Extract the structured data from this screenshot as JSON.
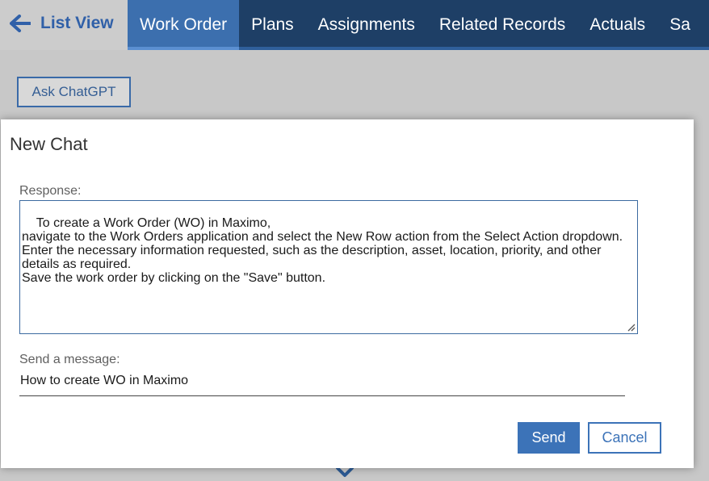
{
  "nav": {
    "list_view_label": "List View",
    "back_icon": "arrow-left-icon",
    "tabs": [
      {
        "label": "Work Order",
        "active": true
      },
      {
        "label": "Plans",
        "active": false
      },
      {
        "label": "Assignments",
        "active": false
      },
      {
        "label": "Related Records",
        "active": false
      },
      {
        "label": "Actuals",
        "active": false
      },
      {
        "label": "Sa",
        "active": false
      }
    ]
  },
  "page": {
    "ask_button_label": "Ask ChatGPT",
    "bottom_icon": "chevron-down-icon"
  },
  "dialog": {
    "title": "New Chat",
    "response_label": "Response:",
    "response_text": "To create a Work Order (WO) in Maximo,\nnavigate to the Work Orders application and select the New Row action from the Select Action dropdown.\nEnter the necessary information requested, such as the description, asset, location, priority, and other details as required.\nSave the work order by clicking on the \"Save\" button.",
    "message_label": "Send a message:",
    "message_value": "How to create WO in Maximo",
    "send_label": "Send",
    "cancel_label": "Cancel"
  },
  "colors": {
    "nav_bg": "#1e3f66",
    "active_tab": "#3c6fae",
    "primary": "#3c73b8"
  }
}
